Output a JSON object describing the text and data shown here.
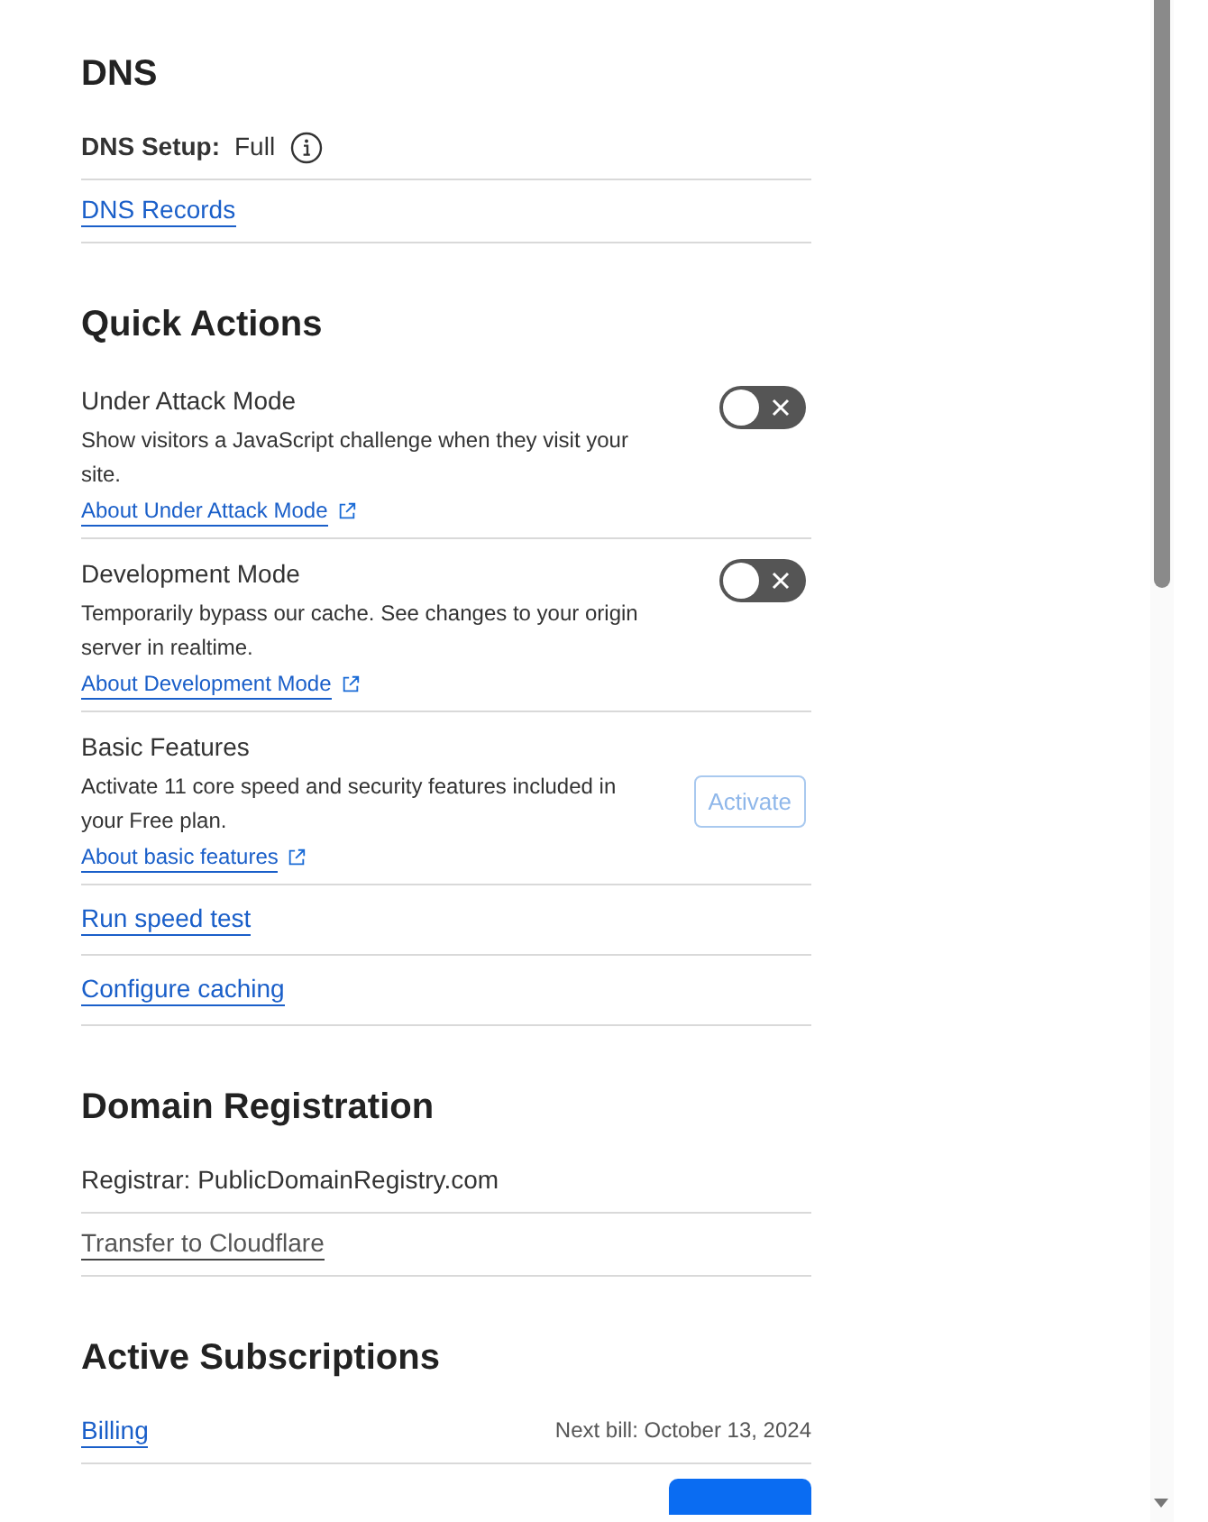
{
  "dns": {
    "title": "DNS",
    "setup_label": "DNS Setup:",
    "setup_value": "Full",
    "records_link": "DNS Records"
  },
  "quick_actions": {
    "title": "Quick Actions",
    "items": [
      {
        "kind": "toggle",
        "title": "Under Attack Mode",
        "description": "Show visitors a JavaScript challenge when they visit your site.",
        "link": "About Under Attack Mode",
        "on": false
      },
      {
        "kind": "toggle",
        "title": "Development Mode",
        "description": "Temporarily bypass our cache. See changes to your origin server in realtime.",
        "link": "About Development Mode",
        "on": false
      },
      {
        "kind": "button",
        "title": "Basic Features",
        "description": "Activate 11 core speed and security features included in your Free plan.",
        "link": "About basic features",
        "button": "Activate",
        "disabled": true
      }
    ],
    "links": [
      "Run speed test",
      "Configure caching"
    ]
  },
  "domain_registration": {
    "title": "Domain Registration",
    "registrar": "Registrar: PublicDomainRegistry.com",
    "transfer_link": "Transfer to Cloudflare"
  },
  "active_subscriptions": {
    "title": "Active Subscriptions",
    "billing_link": "Billing",
    "next_bill": "Next bill: October 13, 2024"
  }
}
